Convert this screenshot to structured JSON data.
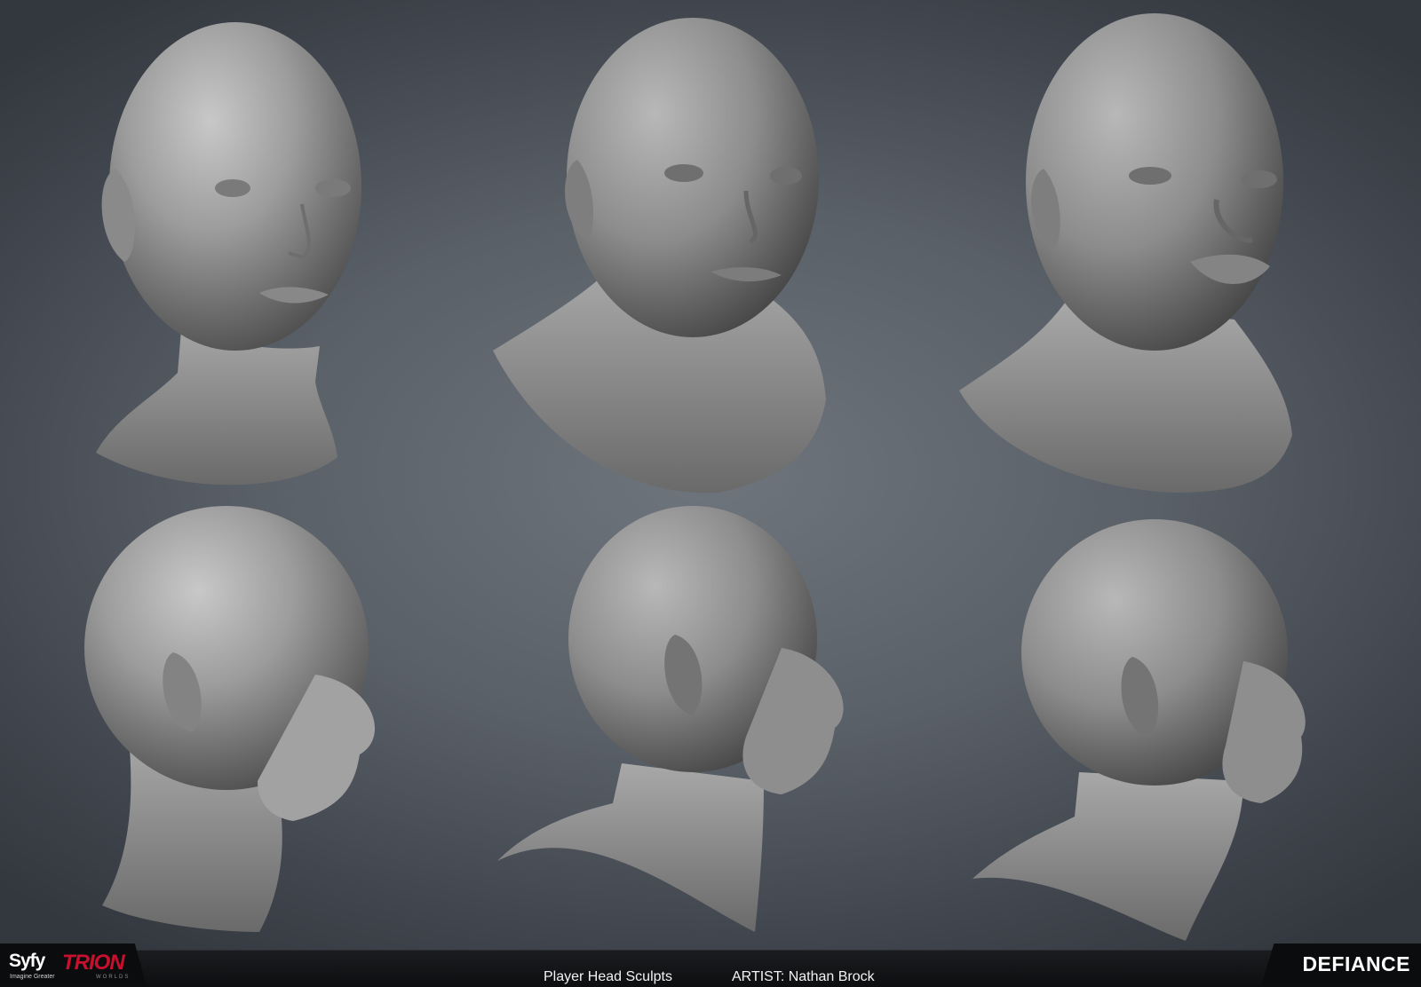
{
  "caption": {
    "title": "Player Head Sculpts",
    "artist": "ARTIST: Nathan Brock"
  },
  "logos": {
    "left_primary": "Syfy",
    "left_primary_tagline": "Imagine Greater",
    "left_secondary": "TRION",
    "left_secondary_sub": "WORLDS",
    "right": "DEFIANCE"
  },
  "colors": {
    "background": "#5a6068",
    "sculpt_clay": "#9a9a9a",
    "footer": "#111214",
    "trion_red": "#c8102e"
  },
  "sculpts": [
    {
      "row": "top",
      "view": "front three-quarter",
      "subject": "female head"
    },
    {
      "row": "top",
      "view": "front three-quarter",
      "subject": "male head"
    },
    {
      "row": "top",
      "view": "front three-quarter",
      "subject": "male head, heavy features"
    },
    {
      "row": "bottom",
      "view": "side profile",
      "subject": "female head"
    },
    {
      "row": "bottom",
      "view": "side profile",
      "subject": "male head"
    },
    {
      "row": "bottom",
      "view": "side profile",
      "subject": "male head, heavy features"
    }
  ]
}
